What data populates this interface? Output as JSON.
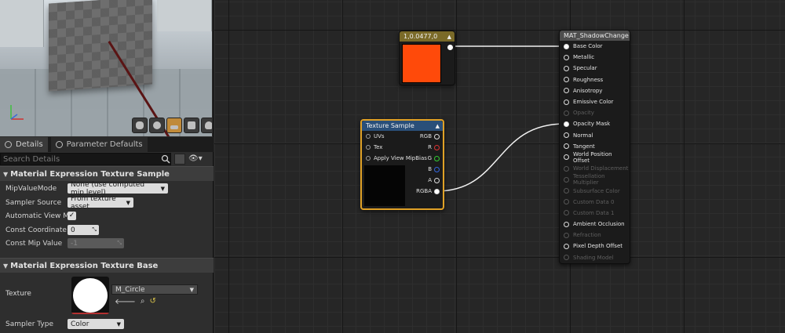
{
  "viewport": {
    "toolbar_icons": [
      "cylinder-icon",
      "sphere-icon",
      "plane-icon",
      "cube-icon",
      "teapot-icon"
    ],
    "active_tool": "plane-icon"
  },
  "tabs": {
    "details": "Details",
    "parameter_defaults": "Parameter Defaults"
  },
  "search": {
    "placeholder": "Search Details"
  },
  "sections": {
    "texture_sample": "Material Expression Texture Sample",
    "texture_base": "Material Expression Texture Base"
  },
  "props": {
    "mip_value_mode": {
      "label": "MipValueMode",
      "value": "None (use computed mip level)"
    },
    "sampler_source": {
      "label": "Sampler Source",
      "value": "From texture asset"
    },
    "auto_view_mip_bias": {
      "label": "Automatic View Mip Bi",
      "checked": "✓"
    },
    "const_coordinate": {
      "label": "Const Coordinate",
      "value": "0"
    },
    "const_mip_value": {
      "label": "Const Mip Value",
      "value": "-1"
    },
    "texture": {
      "label": "Texture",
      "value": "M_Circle"
    },
    "sampler_type": {
      "label": "Sampler Type",
      "value": "Color"
    }
  },
  "graph": {
    "constant_node": {
      "title": "1,0.0477,0",
      "color": "#ff4a0a"
    },
    "texture_node": {
      "title": "Texture Sample",
      "inputs": [
        "UVs",
        "Tex",
        "Apply View MipBias"
      ],
      "outputs": [
        "RGB",
        "R",
        "G",
        "B",
        "A",
        "RGBA"
      ]
    },
    "material_node": {
      "title": "MAT_ShadowChange",
      "pins": [
        {
          "label": "Base Color",
          "enabled": true,
          "connected": true
        },
        {
          "label": "Metallic",
          "enabled": true,
          "connected": false
        },
        {
          "label": "Specular",
          "enabled": true,
          "connected": false
        },
        {
          "label": "Roughness",
          "enabled": true,
          "connected": false
        },
        {
          "label": "Anisotropy",
          "enabled": true,
          "connected": false
        },
        {
          "label": "Emissive Color",
          "enabled": true,
          "connected": false
        },
        {
          "label": "Opacity",
          "enabled": false,
          "connected": false
        },
        {
          "label": "Opacity Mask",
          "enabled": true,
          "connected": true
        },
        {
          "label": "Normal",
          "enabled": true,
          "connected": false
        },
        {
          "label": "Tangent",
          "enabled": true,
          "connected": false
        },
        {
          "label": "World Position Offset",
          "enabled": true,
          "connected": false
        },
        {
          "label": "World Displacement",
          "enabled": false,
          "connected": false
        },
        {
          "label": "Tessellation Multiplier",
          "enabled": false,
          "connected": false
        },
        {
          "label": "Subsurface Color",
          "enabled": false,
          "connected": false
        },
        {
          "label": "Custom Data 0",
          "enabled": false,
          "connected": false
        },
        {
          "label": "Custom Data 1",
          "enabled": false,
          "connected": false
        },
        {
          "label": "Ambient Occlusion",
          "enabled": true,
          "connected": false
        },
        {
          "label": "Refraction",
          "enabled": false,
          "connected": false
        },
        {
          "label": "Pixel Depth Offset",
          "enabled": true,
          "connected": false
        },
        {
          "label": "Shading Model",
          "enabled": false,
          "connected": false
        }
      ]
    }
  }
}
